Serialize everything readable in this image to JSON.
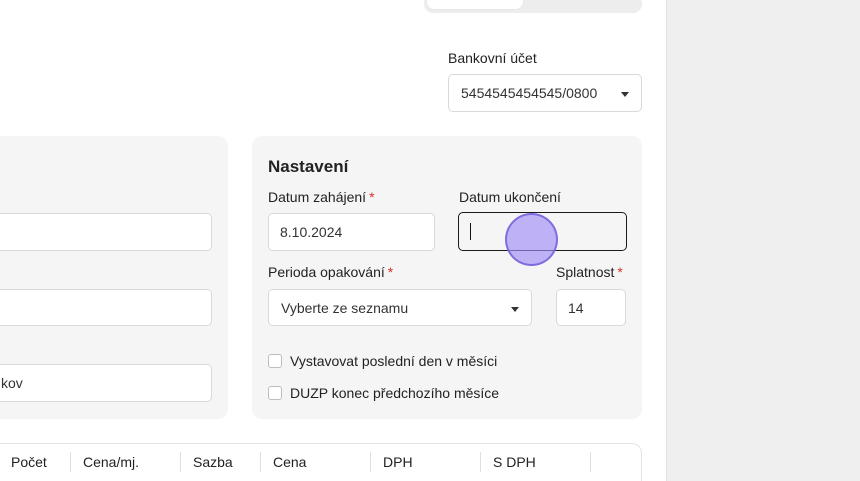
{
  "header": {
    "bank_account_label": "Bankovní účet",
    "bank_account_value": "5454545454545/0800"
  },
  "left_panel": {
    "field_1_value": ".",
    "field_3_value": "kov"
  },
  "settings": {
    "title": "Nastavení",
    "start_date_label": "Datum zahájení",
    "start_date_value": "8.10.2024",
    "end_date_label": "Datum ukončení",
    "end_date_value": "",
    "period_label": "Perioda opakování",
    "period_value": "Vyberte ze seznamu",
    "due_label": "Splatnost",
    "due_value": "14",
    "required_mark": "*",
    "checkbox_last_day": "Vystavovat poslední den v měsíci",
    "checkbox_duzp": "DUZP konec předchozího měsíce"
  },
  "table": {
    "columns": [
      "Počet",
      "Cena/mj.",
      "Sazba",
      "Cena",
      "DPH",
      "S DPH"
    ]
  }
}
